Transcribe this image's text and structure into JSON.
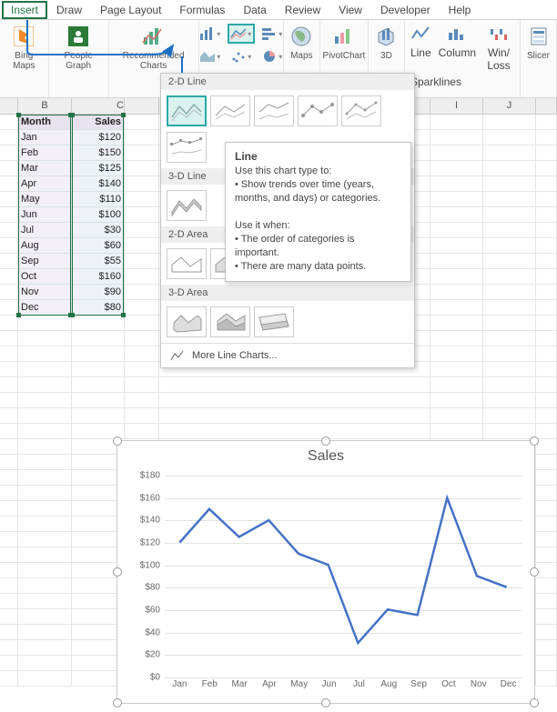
{
  "tabs": [
    "Insert",
    "Draw",
    "Page Layout",
    "Formulas",
    "Data",
    "Review",
    "View",
    "Developer",
    "Help"
  ],
  "activeTab": "Insert",
  "ribbon": {
    "bingMaps": "Bing Maps",
    "peopleGraph": "People Graph",
    "recommendedCharts": "Recommended Charts",
    "maps": "Maps",
    "pivotChart": "PivotChart",
    "3d": "3D",
    "line": "Line",
    "column": "Column",
    "winLoss": "Win/ Loss",
    "sparklines": "Sparklines",
    "slicer": "Slicer"
  },
  "dropdown": {
    "sect1": "2-D Line",
    "sect2": "3-D Line",
    "sect3": "2-D Area",
    "sect4": "3-D Area",
    "more": "More Line Charts..."
  },
  "tooltip": {
    "title": "Line",
    "use": "Use this chart type to:",
    "bul1": "• Show trends over time (years, months, and days) or categories.",
    "when": "Use it when:",
    "bul2": "• The order of categories is important.",
    "bul3": "• There are many data points."
  },
  "table": {
    "headers": {
      "B": "Month",
      "C": "Sales"
    },
    "cols": [
      "B",
      "C",
      "I",
      "J"
    ],
    "rows": [
      {
        "month": "Jan",
        "sales": "$120"
      },
      {
        "month": "Feb",
        "sales": "$150"
      },
      {
        "month": "Mar",
        "sales": "$125"
      },
      {
        "month": "Apr",
        "sales": "$140"
      },
      {
        "month": "May",
        "sales": "$110"
      },
      {
        "month": "Jun",
        "sales": "$100"
      },
      {
        "month": "Jul",
        "sales": "$30"
      },
      {
        "month": "Aug",
        "sales": "$60"
      },
      {
        "month": "Sep",
        "sales": "$55"
      },
      {
        "month": "Oct",
        "sales": "$160"
      },
      {
        "month": "Nov",
        "sales": "$90"
      },
      {
        "month": "Dec",
        "sales": "$80"
      }
    ]
  },
  "chart_data": {
    "type": "line",
    "title": "Sales",
    "categories": [
      "Jan",
      "Feb",
      "Mar",
      "Apr",
      "May",
      "Jun",
      "Jul",
      "Aug",
      "Sep",
      "Oct",
      "Nov",
      "Dec"
    ],
    "values": [
      120,
      150,
      125,
      140,
      110,
      100,
      30,
      60,
      55,
      160,
      90,
      80
    ],
    "ylim": [
      0,
      180
    ],
    "ystep": 20,
    "ylabel_prefix": "$",
    "xlabel": "",
    "ylabel": ""
  }
}
